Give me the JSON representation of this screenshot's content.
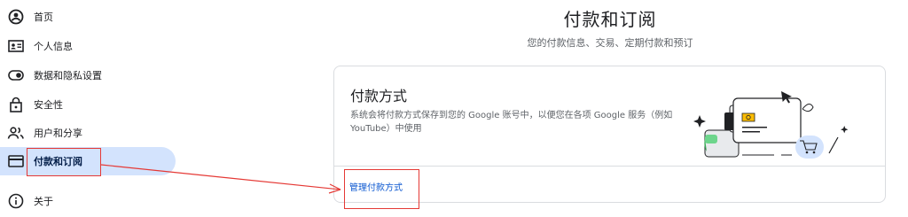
{
  "sidebar": {
    "items": [
      {
        "label": "首页",
        "icon": "account-circle-icon"
      },
      {
        "label": "个人信息",
        "icon": "id-card-icon"
      },
      {
        "label": "数据和隐私设置",
        "icon": "toggle-icon"
      },
      {
        "label": "安全性",
        "icon": "lock-icon"
      },
      {
        "label": "用户和分享",
        "icon": "people-icon"
      },
      {
        "label": "付款和订阅",
        "icon": "credit-card-icon",
        "active": true
      },
      {
        "label": "关于",
        "icon": "info-icon"
      }
    ]
  },
  "header": {
    "title": "付款和订阅",
    "subtitle": "您的付款信息、交易、定期付款和预订"
  },
  "payment_card": {
    "title": "付款方式",
    "description": "系统会将付款方式保存到您的 Google 账号中，以便您在各项 Google 服务（例如 YouTube）中使用",
    "link_label": "管理付款方式"
  },
  "colors": {
    "active_nav_bg": "#d3e3fd",
    "link": "#0b57d0",
    "annotation": "#e53935"
  }
}
